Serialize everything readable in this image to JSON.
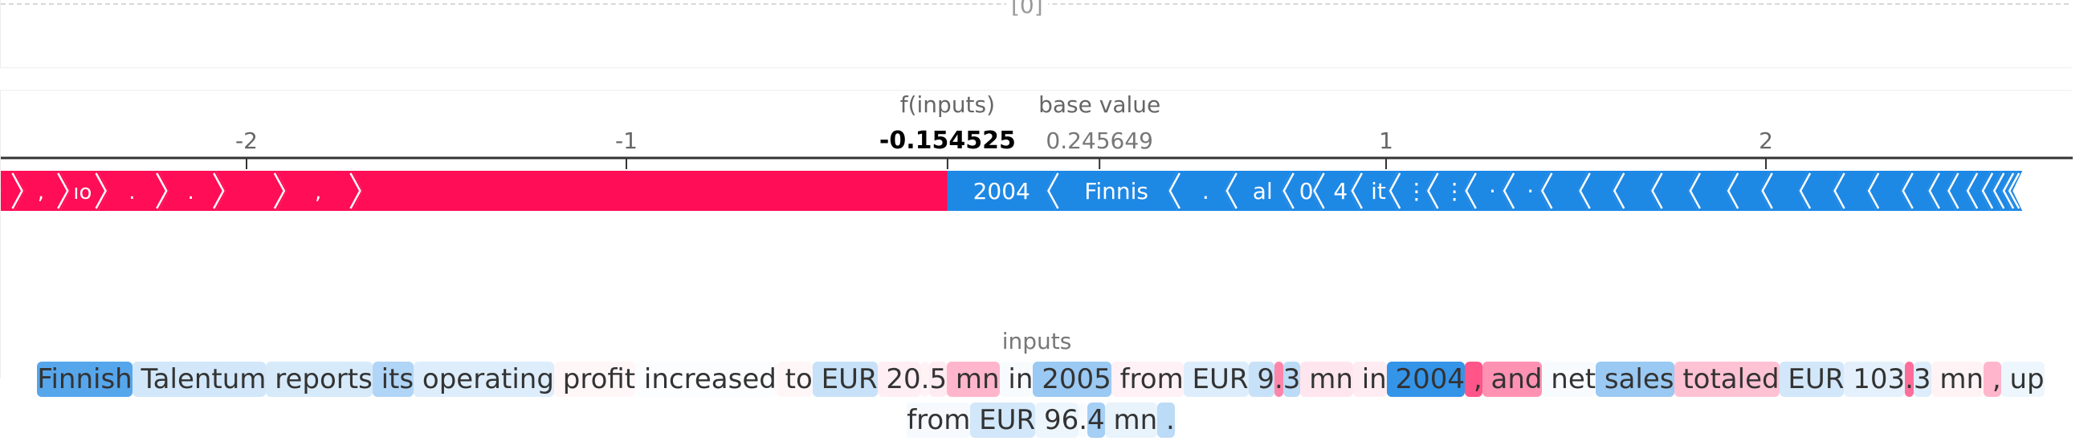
{
  "index_label": "[0]",
  "chart_data": {
    "type": "force",
    "f_inputs_label": "f(inputs)",
    "f_inputs_value": "-0.154525",
    "f_value": -0.154525,
    "base_value_label": "base value",
    "base_value_text": "0.245649",
    "base_value": 0.245649,
    "x_ticks": [
      -2,
      -1,
      1,
      2
    ],
    "xlim": [
      -2.65,
      2.75
    ],
    "negative_segments": [
      {
        "from": -1.72,
        "to": -0.154525,
        "label": ""
      },
      {
        "from": -1.92,
        "to": -1.72,
        "label": ","
      },
      {
        "from": -2.08,
        "to": -1.92,
        "label": ""
      },
      {
        "from": -2.23,
        "to": -2.08,
        "label": "."
      },
      {
        "from": -2.39,
        "to": -2.23,
        "label": "."
      },
      {
        "from": -2.49,
        "to": -2.39,
        "label": "ıo"
      },
      {
        "from": -2.61,
        "to": -2.49,
        "label": ","
      },
      {
        "from": -2.67,
        "to": -2.61,
        "label": ""
      },
      {
        "from": -2.7,
        "to": -2.67,
        "label": ""
      },
      {
        "from": -2.72,
        "to": -2.7,
        "label": ""
      },
      {
        "from": -2.74,
        "to": -2.72,
        "label": ""
      },
      {
        "from": -2.755,
        "to": -2.74,
        "label": ""
      },
      {
        "from": -2.77,
        "to": -2.755,
        "label": ""
      },
      {
        "from": -2.78,
        "to": -2.77,
        "label": ""
      }
    ],
    "positive_segments": [
      {
        "from": -0.154525,
        "to": 0.13,
        "label": "2004"
      },
      {
        "from": 0.13,
        "to": 0.45,
        "label": "Finnis"
      },
      {
        "from": 0.45,
        "to": 0.6,
        "label": "."
      },
      {
        "from": 0.6,
        "to": 0.75,
        "label": "al"
      },
      {
        "from": 0.75,
        "to": 0.83,
        "label": "0"
      },
      {
        "from": 0.83,
        "to": 0.93,
        "label": "4"
      },
      {
        "from": 0.93,
        "to": 1.03,
        "label": "it"
      },
      {
        "from": 1.03,
        "to": 1.13,
        "label": "⋮"
      },
      {
        "from": 1.13,
        "to": 1.23,
        "label": "⋮"
      },
      {
        "from": 1.23,
        "to": 1.33,
        "label": "·"
      },
      {
        "from": 1.33,
        "to": 1.43,
        "label": "·"
      },
      {
        "from": 1.43,
        "to": 1.53,
        "label": ""
      },
      {
        "from": 1.53,
        "to": 1.62,
        "label": ""
      },
      {
        "from": 1.62,
        "to": 1.72,
        "label": ""
      },
      {
        "from": 1.72,
        "to": 1.82,
        "label": ""
      },
      {
        "from": 1.82,
        "to": 1.92,
        "label": ""
      },
      {
        "from": 1.92,
        "to": 2.01,
        "label": ""
      },
      {
        "from": 2.01,
        "to": 2.11,
        "label": ""
      },
      {
        "from": 2.11,
        "to": 2.2,
        "label": ""
      },
      {
        "from": 2.2,
        "to": 2.29,
        "label": ""
      },
      {
        "from": 2.29,
        "to": 2.38,
        "label": ""
      },
      {
        "from": 2.38,
        "to": 2.45,
        "label": ""
      },
      {
        "from": 2.45,
        "to": 2.5,
        "label": ""
      },
      {
        "from": 2.5,
        "to": 2.55,
        "label": ""
      },
      {
        "from": 2.55,
        "to": 2.59,
        "label": ""
      },
      {
        "from": 2.59,
        "to": 2.62,
        "label": ""
      },
      {
        "from": 2.62,
        "to": 2.645,
        "label": ""
      },
      {
        "from": 2.645,
        "to": 2.66,
        "label": ""
      },
      {
        "from": 2.66,
        "to": 2.675,
        "label": ""
      }
    ]
  },
  "inputs_label": "inputs",
  "tokens": [
    {
      "text": "Finnish",
      "sign": 1,
      "a": 0.75
    },
    {
      "text": " Talentum",
      "sign": 1,
      "a": 0.2
    },
    {
      "text": " reports",
      "sign": 1,
      "a": 0.18
    },
    {
      "text": " its",
      "sign": 1,
      "a": 0.35
    },
    {
      "text": " operating",
      "sign": 1,
      "a": 0.15
    },
    {
      "text": " profit",
      "sign": -1,
      "a": 0.04
    },
    {
      "text": " increased",
      "sign": 1,
      "a": 0.02
    },
    {
      "text": " to",
      "sign": -1,
      "a": 0.04
    },
    {
      "text": " EUR",
      "sign": 1,
      "a": 0.25
    },
    {
      "text": " 20",
      "sign": -1,
      "a": 0.07
    },
    {
      "text": ".",
      "sign": -1,
      "a": 0.05
    },
    {
      "text": "5",
      "sign": -1,
      "a": 0.08
    },
    {
      "text": " mn",
      "sign": -1,
      "a": 0.3
    },
    {
      "text": " in",
      "sign": 1,
      "a": 0.03
    },
    {
      "text": " 2005",
      "sign": 1,
      "a": 0.45
    },
    {
      "text": " from",
      "sign": -1,
      "a": 0.06
    },
    {
      "text": " EUR",
      "sign": 1,
      "a": 0.15
    },
    {
      "text": " 9",
      "sign": 1,
      "a": 0.25
    },
    {
      "text": ".",
      "sign": -1,
      "a": 0.5
    },
    {
      "text": "3",
      "sign": 1,
      "a": 0.3
    },
    {
      "text": " mn",
      "sign": -1,
      "a": 0.1
    },
    {
      "text": " in",
      "sign": -1,
      "a": 0.08
    },
    {
      "text": " 2004",
      "sign": 1,
      "a": 0.9
    },
    {
      "text": " ,",
      "sign": -1,
      "a": 0.7
    },
    {
      "text": " and",
      "sign": -1,
      "a": 0.45
    },
    {
      "text": " net",
      "sign": 1,
      "a": 0.03
    },
    {
      "text": " sales",
      "sign": 1,
      "a": 0.45
    },
    {
      "text": " totaled",
      "sign": -1,
      "a": 0.25
    },
    {
      "text": " EUR",
      "sign": 1,
      "a": 0.2
    },
    {
      "text": " 103",
      "sign": 1,
      "a": 0.12
    },
    {
      "text": ".",
      "sign": -1,
      "a": 0.6
    },
    {
      "text": "3",
      "sign": 1,
      "a": 0.15
    },
    {
      "text": " mn",
      "sign": -1,
      "a": 0.05
    },
    {
      "text": " ,",
      "sign": -1,
      "a": 0.3
    },
    {
      "text": " up",
      "sign": 1,
      "a": 0.08
    },
    {
      "text": " from",
      "sign": 1,
      "a": 0.04
    },
    {
      "text": " EUR",
      "sign": 1,
      "a": 0.2
    },
    {
      "text": " 96",
      "sign": 1,
      "a": 0.08
    },
    {
      "text": ".",
      "sign": 1,
      "a": 0.03
    },
    {
      "text": "4",
      "sign": 1,
      "a": 0.4
    },
    {
      "text": " mn",
      "sign": 1,
      "a": 0.1
    },
    {
      "text": " .",
      "sign": 1,
      "a": 0.3
    }
  ],
  "colors": {
    "negative": "#ff0d57",
    "positive": "#1e88e5",
    "axis": "#333333"
  }
}
